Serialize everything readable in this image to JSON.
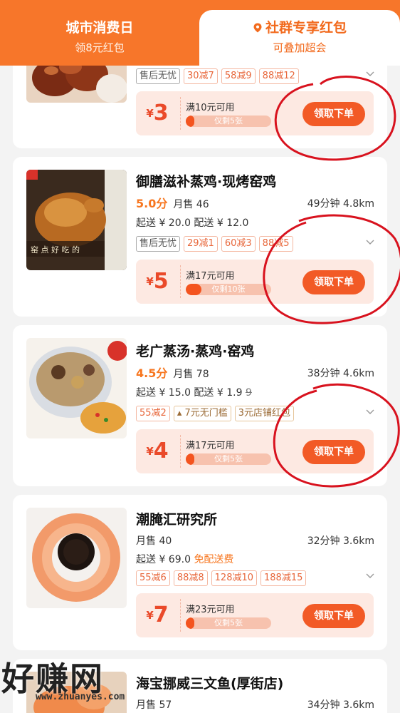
{
  "header": {
    "tab_left_title": "城市消费日",
    "tab_left_sub": "领8元红包",
    "tab_right_title": "社群专享红包",
    "tab_right_sub": "可叠加超会"
  },
  "colors": {
    "accent": "#f7762a",
    "coupon_bg": "#fde9e2",
    "button": "#f25a26"
  },
  "shops": [
    {
      "name": "",
      "tags": [
        "售后无忧",
        "30减7",
        "58减9",
        "88减12"
      ],
      "coupon": {
        "yen": "¥",
        "amount": "3",
        "condition": "满10元可用",
        "remaining": "仅剩5张",
        "remaining_fraction": 0.1,
        "button": "领取下单"
      }
    },
    {
      "name": "御膳滋补蒸鸡·现烤窑鸡",
      "rating": "5.0分",
      "sales": "月售 46",
      "time_dist": "49分钟 4.8km",
      "fees": "起送 ¥ 20.0  配送 ¥ 12.0",
      "tags": [
        "售后无忧",
        "29减1",
        "60减3",
        "88减5"
      ],
      "coupon": {
        "yen": "¥",
        "amount": "5",
        "condition": "满17元可用",
        "remaining": "仅剩10张",
        "remaining_fraction": 0.18,
        "button": "领取下单"
      }
    },
    {
      "name": "老广蒸汤·蒸鸡·窑鸡",
      "rating": "4.5分",
      "sales": "月售 78",
      "time_dist": "38分钟 4.6km",
      "fees": "起送 ¥ 15.0  配送 ¥ 1.9",
      "fees_strike": "9",
      "tags": [
        "55减2",
        "7元无门槛",
        "3元店铺红包"
      ],
      "coupon": {
        "yen": "¥",
        "amount": "4",
        "condition": "满17元可用",
        "remaining": "仅剩5张",
        "remaining_fraction": 0.1,
        "button": "领取下单"
      }
    },
    {
      "name": "潮腌汇研究所",
      "sales": "月售 40",
      "time_dist": "32分钟 3.6km",
      "fees": "起送 ¥ 69.0",
      "fees_free": "免配送费",
      "tags": [
        "55减6",
        "88减8",
        "128减10",
        "188减15"
      ],
      "coupon": {
        "yen": "¥",
        "amount": "7",
        "condition": "满23元可用",
        "remaining": "仅剩5张",
        "remaining_fraction": 0.1,
        "button": "领取下单"
      }
    },
    {
      "name": "海宝挪威三文鱼(厚街店)",
      "sales": "月售 57",
      "time_dist": "34分钟 3.6km"
    }
  ],
  "watermark": {
    "text": "好赚网",
    "url": "www.zhuanyes.com"
  }
}
